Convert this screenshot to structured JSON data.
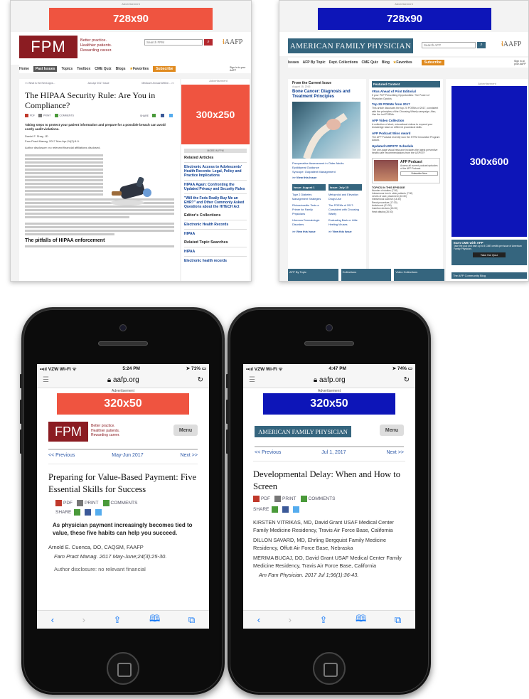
{
  "colors": {
    "ad_red": "#ef5440",
    "ad_blue": "#0d15b8",
    "fpm_red": "#8b1c22",
    "afp_teal": "#35657e"
  },
  "fpm_desktop": {
    "banner": "728x90",
    "logo": "FPM",
    "tagline": [
      "Better practice.",
      "Healthier patients.",
      "Rewarding career."
    ],
    "search_placeholder": "Search FPM",
    "aafp": "AAFP",
    "nav": [
      "Home",
      "Past Issues",
      "Topics",
      "Toolbox",
      "CME Quiz",
      "Blogs",
      "Favorites",
      "Subscribe"
    ],
    "signin": "Sign in to your AAFP",
    "prevnext": [
      "<< What is the Next Apps...",
      "Jan-Apr 2017 Issue",
      "Medicare Annual Wellne... >>"
    ],
    "title": "The HIPAA Security Rule: Are You in Compliance?",
    "actions": [
      "PDF",
      "PRINT",
      "COMMENTS",
      "SHARE"
    ],
    "lead": "Taking steps to protect your patient information and prepare for a possible breach can avoid costly audit violations.",
    "author": "Daniel F. Shay, JD",
    "cite": "Fam Pract Manag. 2017 Mar-Apr;24(2):5-9.",
    "disclosure": "Author disclosure: no relevant financial affiliations disclosed.",
    "section": "The pitfalls of HIPAA enforcement",
    "ad_box": "300x250",
    "more_label": "MORE IN FPM",
    "related_title": "Related Articles",
    "related": [
      "Electronic Access to Adolescents' Health Records: Legal, Policy and Practice Implications",
      "HIPAA Again: Confronting the Updated Privacy and Security Rules",
      "\"Will the Feds Really Buy Me an EHR?\" and Other Commonly Asked Questions about the HITECH Act"
    ],
    "editors_title": "Editor's Collections",
    "editors": [
      "Electronic Health Records",
      "HIPAA"
    ],
    "searches_title": "Related Topic Searches",
    "searches": [
      "HIPAA",
      "Electronic health records"
    ]
  },
  "afp_desktop": {
    "banner": "728x90",
    "logo": "AMERICAN FAMILY PHYSICIAN",
    "search_placeholder": "Search AFP",
    "aafp": "AAFP",
    "nav": [
      "Issues",
      "AFP By Topic",
      "Dept. Collections",
      "CME Quiz",
      "Blog",
      "Favorites",
      "Subscribe"
    ],
    "signin": "Sign in at your AAFP",
    "current_label": "From the Current Issue",
    "current_date": "August 15, 2016",
    "current_title": "Bone Cancer: Diagnosis and Treatment Principles",
    "bullets": [
      "Preoperative Assessment in Older Adults",
      "Epididymal Guidance",
      "Syncope: Outpatient Management"
    ],
    "view_issue": ">> View this Issue",
    "issue_tabs": [
      "Issue: August 1",
      "Issue: July 15"
    ],
    "col1": [
      "Type 2 Diabetes Management Strategies",
      "Rhinosinusitis: Tests a Primer for Family Physicians",
      "Ulcerous Dermatologic Disorders"
    ],
    "col2": [
      "Metoprolol and Elevation Drugs Use",
      "The POEMs of 2017: Consistent with Choosing Wisely",
      "Evaluating Back or Little Heeling Viruses"
    ],
    "view_issue2": ">> View this Issue",
    "featured_label": "Featured Content",
    "featured": [
      {
        "t": "#Rxs Ahead of Print Editorial",
        "d": "If your PCP Prescribing Opportunities: The Power of Physician Opioids"
      },
      {
        "t": "Top 20 POEMs from 2017",
        "d": "This article discusses the top 20 POEMs of 2017, consistent with the principles of the Choosing Wisely campaign. Also, Use the hot POEMs."
      },
      {
        "t": "AFP Video Collection",
        "d": "A collection of short, educational videos to expand your knowledge base on different procedural skills."
      },
      {
        "t": "AFP Podcast Wins Award",
        "d": "The AFP Podcast recently won the STFM Innovative Program Award."
      },
      {
        "t": "Updated USPSTF Schedule",
        "d": "The one-page visual resource includes the latest preventive health care recommendations from the USPSTF."
      }
    ],
    "podcast_title": "AFP Podcast",
    "podcast_desc": "Access all current podcast episodes of the AFP Podcast.",
    "podcast_btn": "Subscribe Now",
    "topics_label": "TOPICS IN THIS EPISODE",
    "topics": [
      "Number of studies (7:30)",
      "Intravenous iron in older patients (7:30)",
      "Levels of care, placement (10:30)",
      "Intravenous sucrose (14:30)",
      "Renal procedure (17:30)",
      "Antichronic (21:30)",
      "Insertion devices (24:30)",
      "Heat attacks (26:30)"
    ],
    "ad_box": "300x600",
    "cme_title": "Earn CME with AFP",
    "cme_desc": "Take the quiz and earn up to 5 CME credits per issue of American Family Physician.",
    "cme_btn": "Take the Quiz",
    "bottom_tabs": [
      "AFP By Topic",
      "Collections",
      "Video Collections"
    ],
    "community": "The AFP Community Blog"
  },
  "phone_fpm": {
    "carrier": "VZW Wi-Fi",
    "time": "5:24 PM",
    "battery": "71%",
    "url": "aafp.org",
    "ad_label": "Advertisement",
    "banner": "320x50",
    "logo": "FPM",
    "tagline": [
      "Better practice.",
      "Healthier patients.",
      "Rewarding career."
    ],
    "menu": "Menu",
    "prev": "<< Previous",
    "issue": "May-Jun 2017",
    "next": "Next >>",
    "title": "Preparing for Value-Based Payment: Five Essential Skills for Success",
    "actions": [
      "PDF",
      "PRINT",
      "COMMENTS"
    ],
    "share": "SHARE",
    "lead": "As physician payment increasingly becomes tied to value, these five habits can help you succeed.",
    "author": "Arnold E. Cuenca, DO, CAQSM, FAAFP",
    "cite": "Fam Pract Manag. 2017 May-June;24(3):25-30.",
    "disclosure": "Author disclosure: no relevant financial"
  },
  "phone_afp": {
    "carrier": "VZW Wi-Fi",
    "time": "4:47 PM",
    "battery": "74%",
    "url": "aafp.org",
    "ad_label": "Advertisement",
    "banner": "320x50",
    "logo": "AMERICAN FAMILY PHYSICIAN",
    "menu": "Menu",
    "prev": "<< Previous",
    "issue": "Jul 1, 2017",
    "next": "Next >>",
    "title": "Developmental Delay: When and How to Screen",
    "actions": [
      "PDF",
      "PRINT",
      "COMMENTS"
    ],
    "share": "SHARE",
    "authors": [
      "KIRSTEN VITRIKAS, MD, David Grant USAF Medical Center Family Medicine Residency, Travis Air Force Base, California",
      "DILLON SAVARD, MD, Ehrling Bergquist Family Medicine Residency, Offutt Air Force Base, Nebraska",
      "MERIMA BUCAJ, DO, David Grant USAF Medical Center Family Medicine Residency, Travis Air Force Base, California"
    ],
    "cite": "Am Fam Physician. 2017 Jul 1;96(1):36-43."
  }
}
